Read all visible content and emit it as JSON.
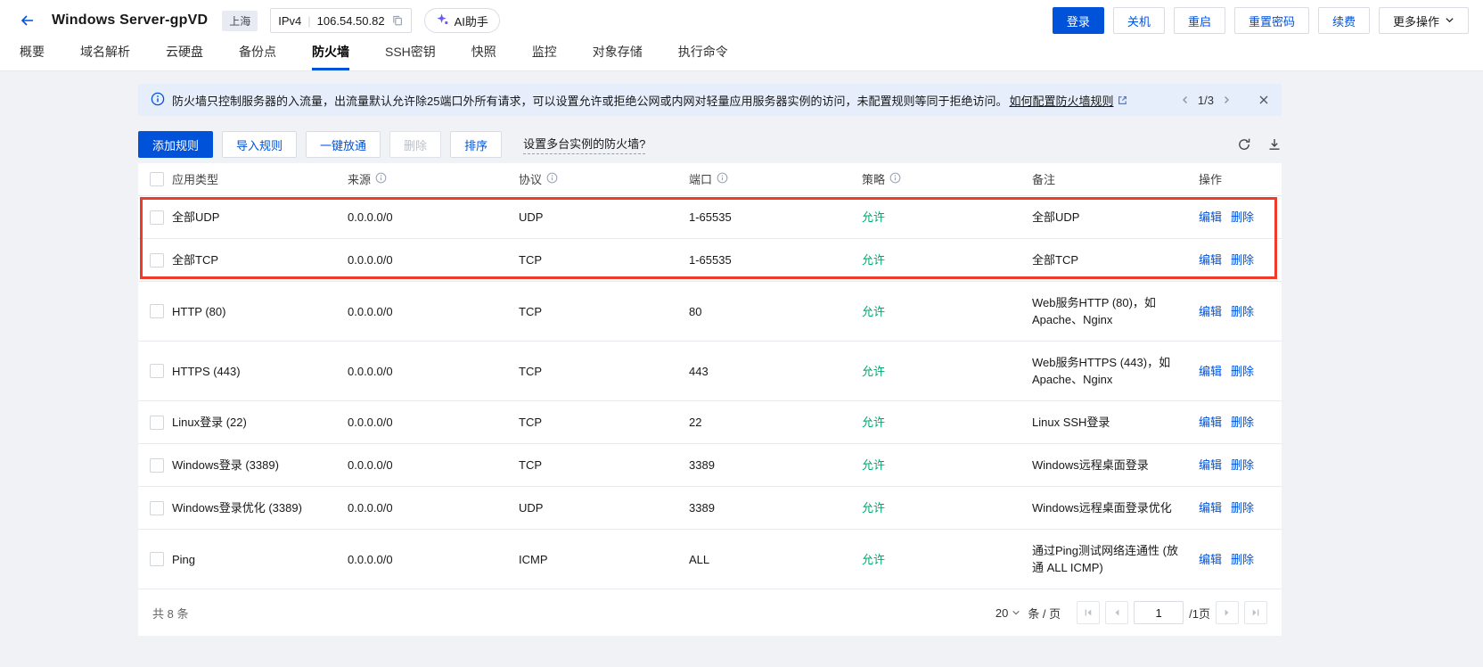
{
  "header": {
    "title": "Windows Server-gpVD",
    "region_badge": "上海",
    "ip": {
      "label": "IPv4",
      "value": "106.54.50.82"
    },
    "ai_button_label": "AI助手",
    "actions": [
      {
        "label": "登录"
      },
      {
        "label": "关机"
      },
      {
        "label": "重启"
      },
      {
        "label": "重置密码"
      },
      {
        "label": "续费"
      },
      {
        "label": "更多操作"
      }
    ]
  },
  "tabs": {
    "active": "防火墙",
    "items": [
      {
        "label": "概要"
      },
      {
        "label": "域名解析"
      },
      {
        "label": "云硬盘"
      },
      {
        "label": "备份点"
      },
      {
        "label": "防火墙"
      },
      {
        "label": "SSH密钥"
      },
      {
        "label": "快照"
      },
      {
        "label": "监控"
      },
      {
        "label": "对象存储"
      },
      {
        "label": "执行命令"
      }
    ]
  },
  "banner": {
    "text": "防火墙只控制服务器的入流量，出流量默认允许除25端口外所有请求，可以设置允许或拒绝公网或内网对轻量应用服务器实例的访问，未配置规则等同于拒绝访问。",
    "link_label": "如何配置防火墙规则",
    "pager": "1/3"
  },
  "toolbar": {
    "add_rule": "添加规则",
    "import_rule": "导入规则",
    "open_all": "一键放通",
    "delete": "删除",
    "sort": "排序",
    "multi_instance_link": "设置多台实例的防火墙?"
  },
  "table": {
    "columns": [
      {
        "label": "应用类型",
        "info": false
      },
      {
        "label": "来源",
        "info": true
      },
      {
        "label": "协议",
        "info": true
      },
      {
        "label": "端口",
        "info": true
      },
      {
        "label": "策略",
        "info": true
      },
      {
        "label": "备注",
        "info": false
      },
      {
        "label": "操作",
        "info": false
      }
    ],
    "edit_label": "编辑",
    "delete_label": "删除",
    "rows": [
      {
        "app": "全部UDP",
        "source": "0.0.0.0/0",
        "protocol": "UDP",
        "port": "1-65535",
        "policy": "允许",
        "remark": "全部UDP",
        "highlight": true
      },
      {
        "app": "全部TCP",
        "source": "0.0.0.0/0",
        "protocol": "TCP",
        "port": "1-65535",
        "policy": "允许",
        "remark": "全部TCP",
        "highlight": true
      },
      {
        "app": "HTTP (80)",
        "source": "0.0.0.0/0",
        "protocol": "TCP",
        "port": "80",
        "policy": "允许",
        "remark": "Web服务HTTP (80)，如 Apache、Nginx",
        "highlight": false
      },
      {
        "app": "HTTPS (443)",
        "source": "0.0.0.0/0",
        "protocol": "TCP",
        "port": "443",
        "policy": "允许",
        "remark": "Web服务HTTPS (443)，如 Apache、Nginx",
        "highlight": false
      },
      {
        "app": "Linux登录 (22)",
        "source": "0.0.0.0/0",
        "protocol": "TCP",
        "port": "22",
        "policy": "允许",
        "remark": "Linux SSH登录",
        "highlight": false
      },
      {
        "app": "Windows登录 (3389)",
        "source": "0.0.0.0/0",
        "protocol": "TCP",
        "port": "3389",
        "policy": "允许",
        "remark": "Windows远程桌面登录",
        "highlight": false
      },
      {
        "app": "Windows登录优化 (3389)",
        "source": "0.0.0.0/0",
        "protocol": "UDP",
        "port": "3389",
        "policy": "允许",
        "remark": "Windows远程桌面登录优化",
        "highlight": false
      },
      {
        "app": "Ping",
        "source": "0.0.0.0/0",
        "protocol": "ICMP",
        "port": "ALL",
        "policy": "允许",
        "remark": "通过Ping测试网络连通性 (放通 ALL ICMP)",
        "highlight": false
      }
    ]
  },
  "footer": {
    "total": "共 8 条",
    "page_size": "20",
    "per_page_label": "条 / 页",
    "current_page": "1",
    "page_total_label": "/1页"
  },
  "colors": {
    "accent_blue": "#0052d9",
    "allow_green": "#00a870",
    "highlight_red": "#ee3b2b",
    "banner_bg": "#e6eefb"
  },
  "icons": {
    "back": "arrow-left-icon",
    "copy": "copy-icon",
    "ai": "sparkle-icon",
    "info": "info-circle-icon",
    "external": "external-link-icon",
    "refresh": "refresh-icon",
    "download": "download-icon",
    "close": "close-icon"
  }
}
